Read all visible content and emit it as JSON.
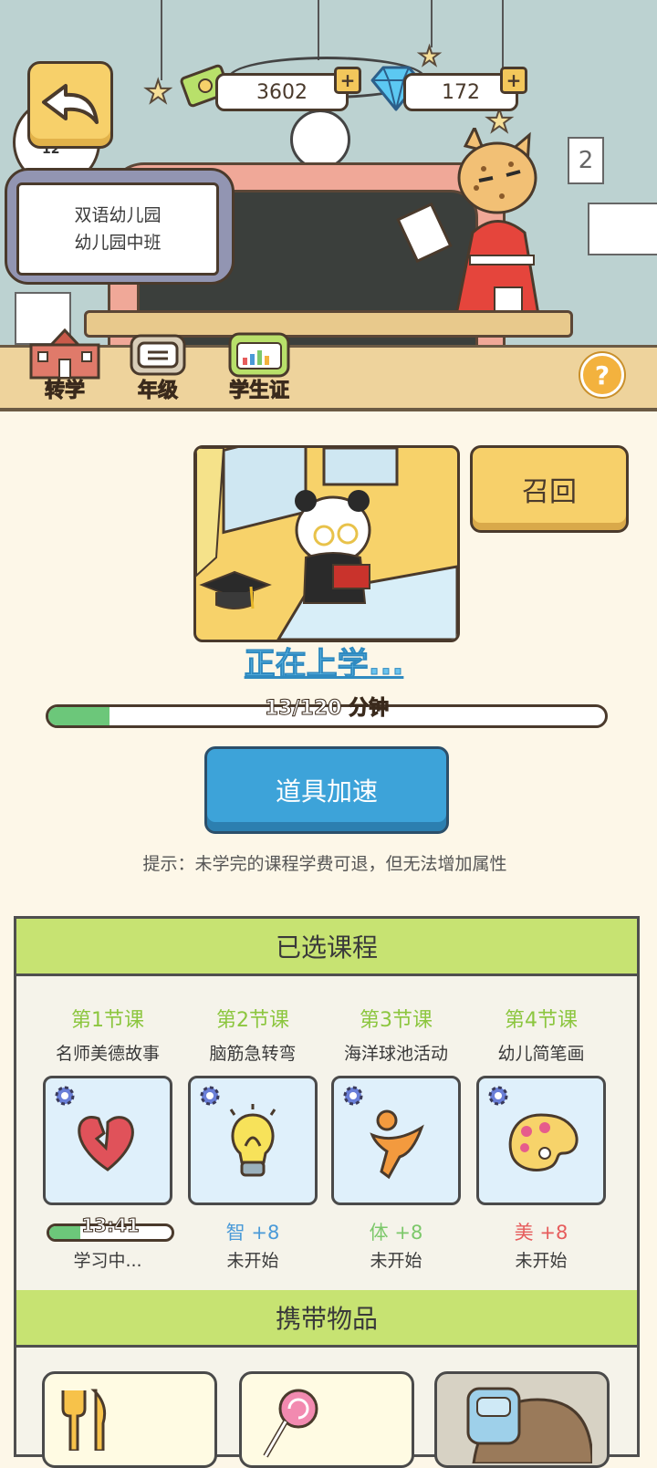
{
  "currency": {
    "cash": "3602",
    "gems": "172"
  },
  "scene": {
    "room_number": "12",
    "wall_note": "2"
  },
  "school_sign": {
    "line1": "双语幼儿园",
    "line2": "幼儿园中班"
  },
  "menu": [
    {
      "label": "转学",
      "icon": "school-building-icon"
    },
    {
      "label": "年级",
      "icon": "grade-book-icon"
    },
    {
      "label": "学生证",
      "icon": "student-id-icon"
    }
  ],
  "help_label": "?",
  "recall_label": "召回",
  "status_title": "正在上学...",
  "progress": {
    "text": "13/120 分钟",
    "fraction": 0.11
  },
  "boost_label": "道具加速",
  "hint": "提示：未学完的课程学费可退，但无法增加属性",
  "course_panel_title": "已选课程",
  "courses": [
    {
      "lesson": "第1节课",
      "name": "名师美德故事",
      "icon": "heart-icon",
      "timer": "13:41",
      "timer_fraction": 0.25,
      "attr": "",
      "status": "学习中..."
    },
    {
      "lesson": "第2节课",
      "name": "脑筋急转弯",
      "icon": "lightbulb-icon",
      "timer": "",
      "attr": "智 +8",
      "attr_color": "#4a9ad8",
      "status": "未开始"
    },
    {
      "lesson": "第3节课",
      "name": "海洋球池活动",
      "icon": "runner-icon",
      "timer": "",
      "attr": "体 +8",
      "attr_color": "#7cc86a",
      "status": "未开始"
    },
    {
      "lesson": "第4节课",
      "name": "幼儿简笔画",
      "icon": "palette-icon",
      "timer": "",
      "attr": "美 +8",
      "attr_color": "#e65c5c",
      "status": "未开始"
    }
  ],
  "items_panel_title": "携带物品",
  "items": [
    {
      "icon": "fork-knife-icon"
    },
    {
      "icon": "lollipop-icon"
    },
    {
      "icon": "backpack-icon"
    }
  ],
  "colors": {
    "accent_green": "#c7e372",
    "button_yellow": "#f7d06a",
    "button_blue": "#3da3d9",
    "progress_green": "#6cc77a"
  }
}
